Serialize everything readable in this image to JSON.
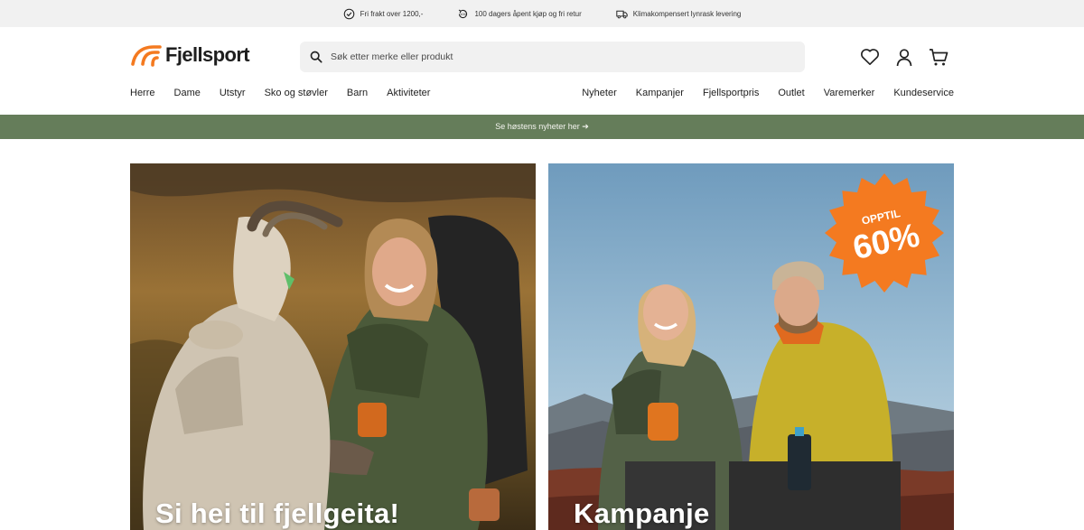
{
  "usps": [
    {
      "icon": "check-circle-icon",
      "text": "Fri frakt over 1200,-"
    },
    {
      "icon": "return-icon",
      "text": "100 dagers åpent kjøp og fri retur"
    },
    {
      "icon": "truck-icon",
      "text": "Klimakompensert lynrask levering"
    }
  ],
  "header": {
    "logo_text": "Fjellsport",
    "search_placeholder": "Søk etter merke eller produkt",
    "brand_orange": "#f47a20"
  },
  "nav": {
    "left": [
      "Herre",
      "Dame",
      "Utstyr",
      "Sko og støvler",
      "Barn",
      "Aktiviteter"
    ],
    "right": [
      "Nyheter",
      "Kampanjer",
      "Fjellsportpris",
      "Outlet",
      "Varemerker",
      "Kundeservice"
    ]
  },
  "promo": {
    "text": "Se høstens nyheter her ➔",
    "color": "#657d5a"
  },
  "cards": [
    {
      "title": "Si hei til fjellgeita!"
    },
    {
      "title": "Kampanje",
      "badge_top": "OPPTIL",
      "badge_value": "60%",
      "badge_color": "#f47a20"
    }
  ]
}
